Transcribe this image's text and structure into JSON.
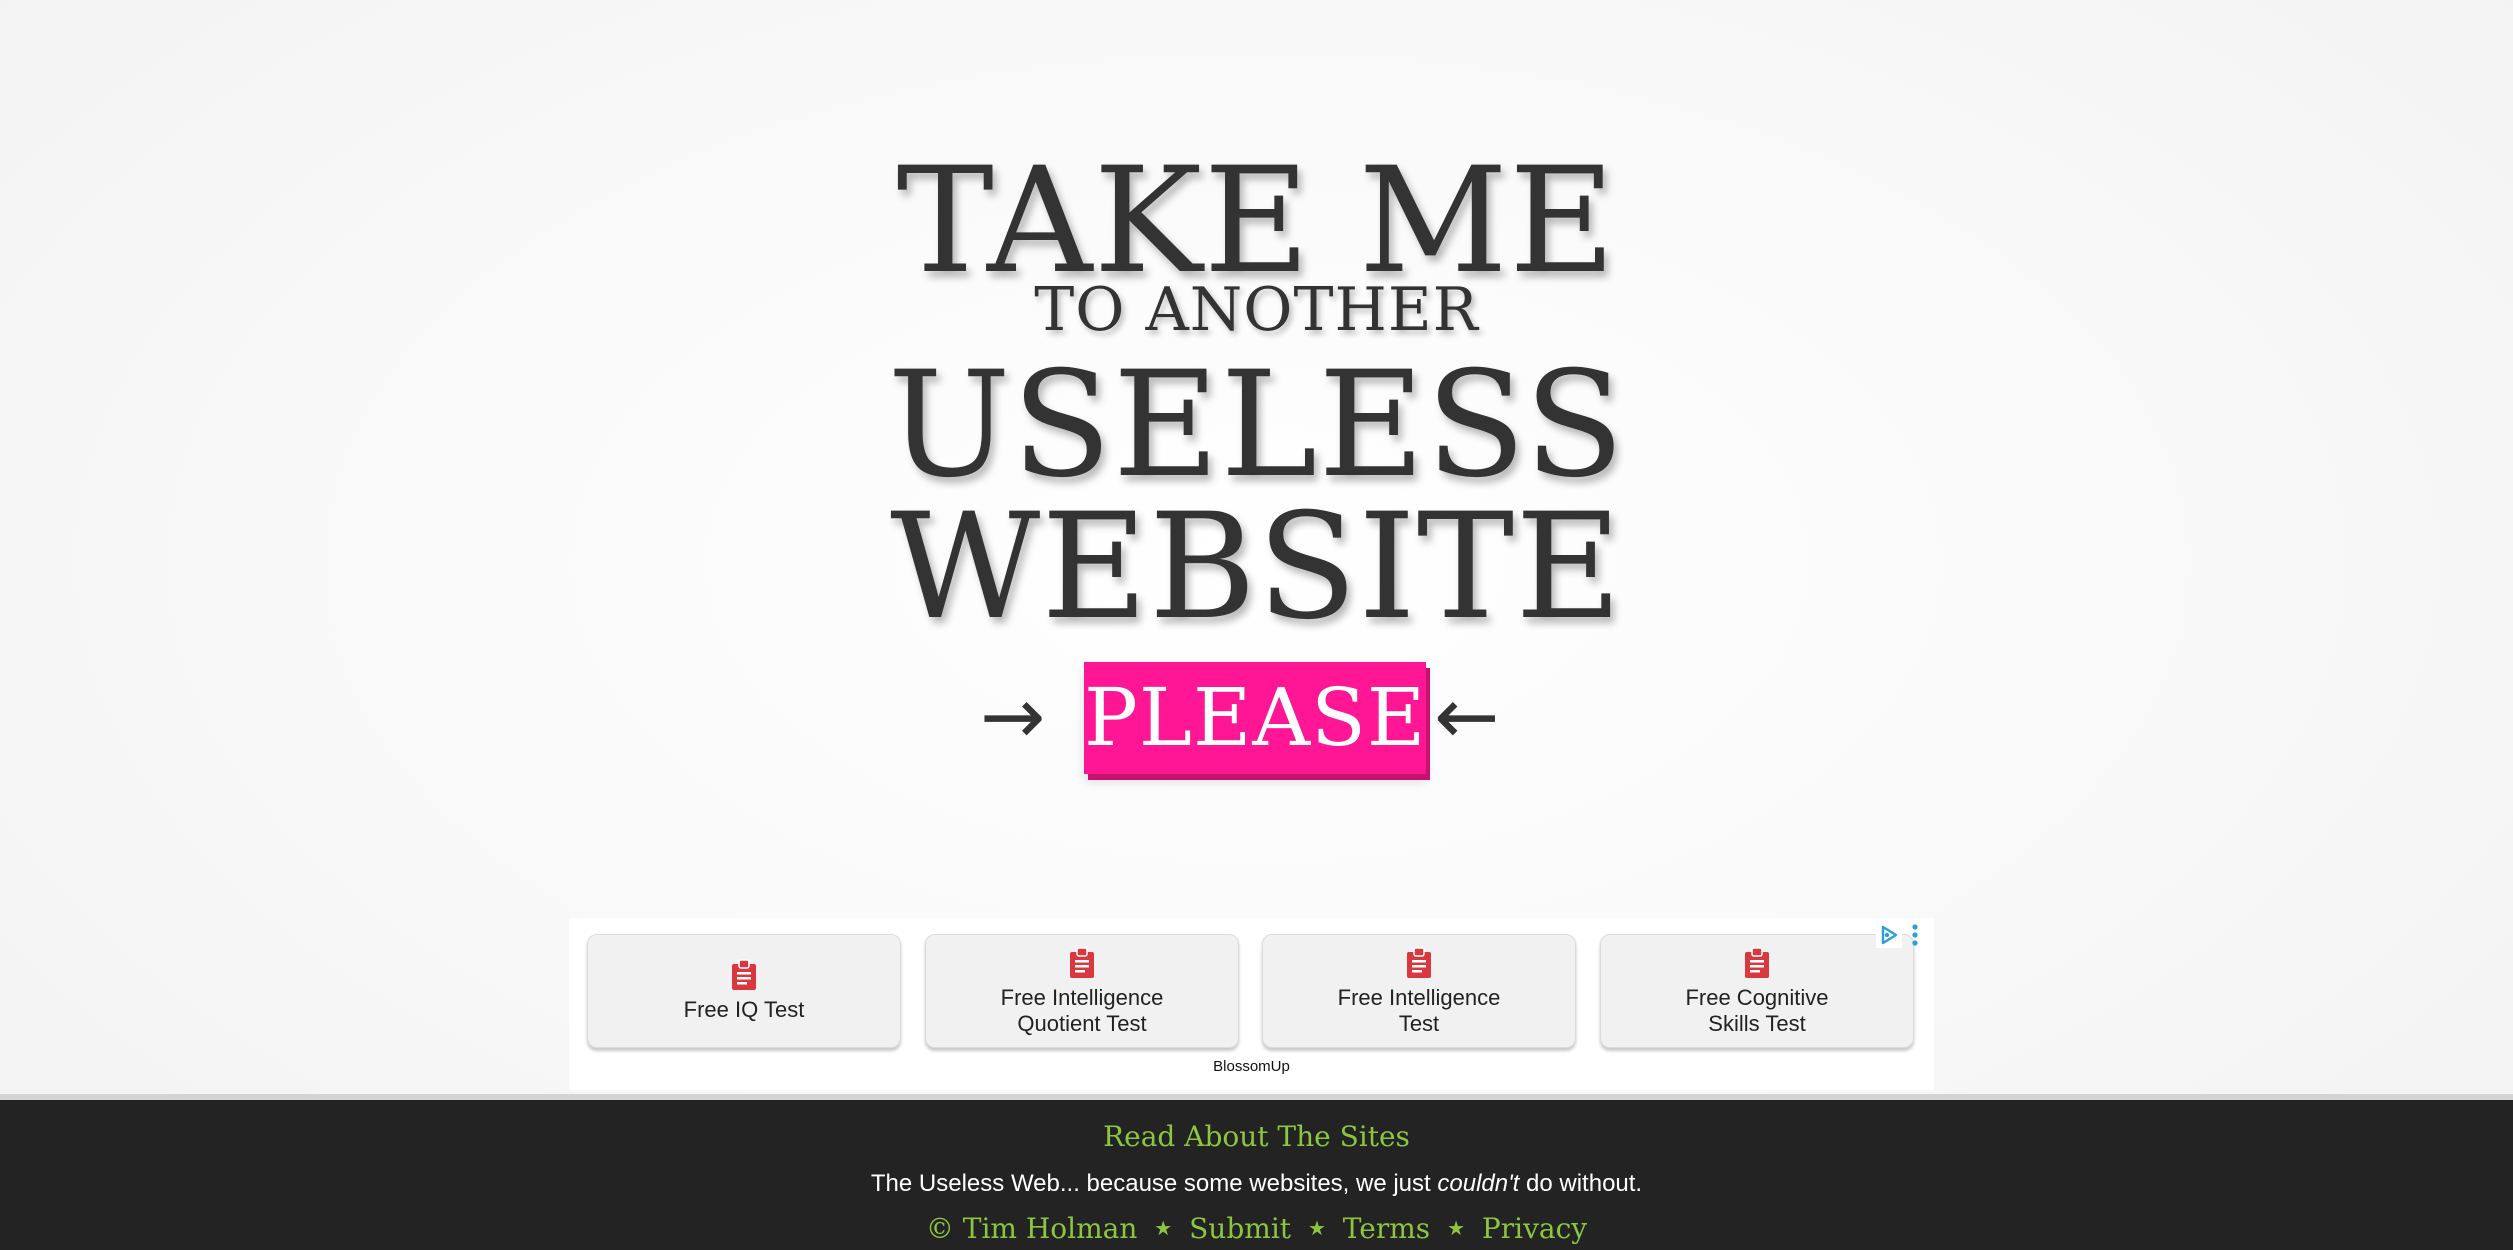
{
  "hero": {
    "line1": "TAKE ME",
    "line2": "TO ANOTHER",
    "line3": "USELESS",
    "line4": "WEBSITE"
  },
  "please": {
    "label": "PLEASE",
    "arrow_left": "→",
    "arrow_right": "←",
    "color": "#ff1694"
  },
  "ad": {
    "cards": [
      {
        "line1": "Free IQ Test",
        "line2": ""
      },
      {
        "line1": "Free Intelligence",
        "line2": "Quotient Test"
      },
      {
        "line1": "Free Intelligence",
        "line2": "Test"
      },
      {
        "line1": "Free Cognitive",
        "line2": "Skills Test"
      }
    ],
    "source": "BlossomUp",
    "icon": "clipboard-icon",
    "icon_color": "#d9383f"
  },
  "footer": {
    "heading": "Read About The Sites",
    "tagline_pre": "The Useless Web... because some websites, we just ",
    "tagline_em": "couldn't",
    "tagline_post": " do without.",
    "copyright_symbol": "©",
    "author": "Tim Holman",
    "separator": "★",
    "links": [
      "Submit",
      "Terms",
      "Privacy"
    ],
    "accent_color": "#8cc63f",
    "background": "#232323"
  }
}
